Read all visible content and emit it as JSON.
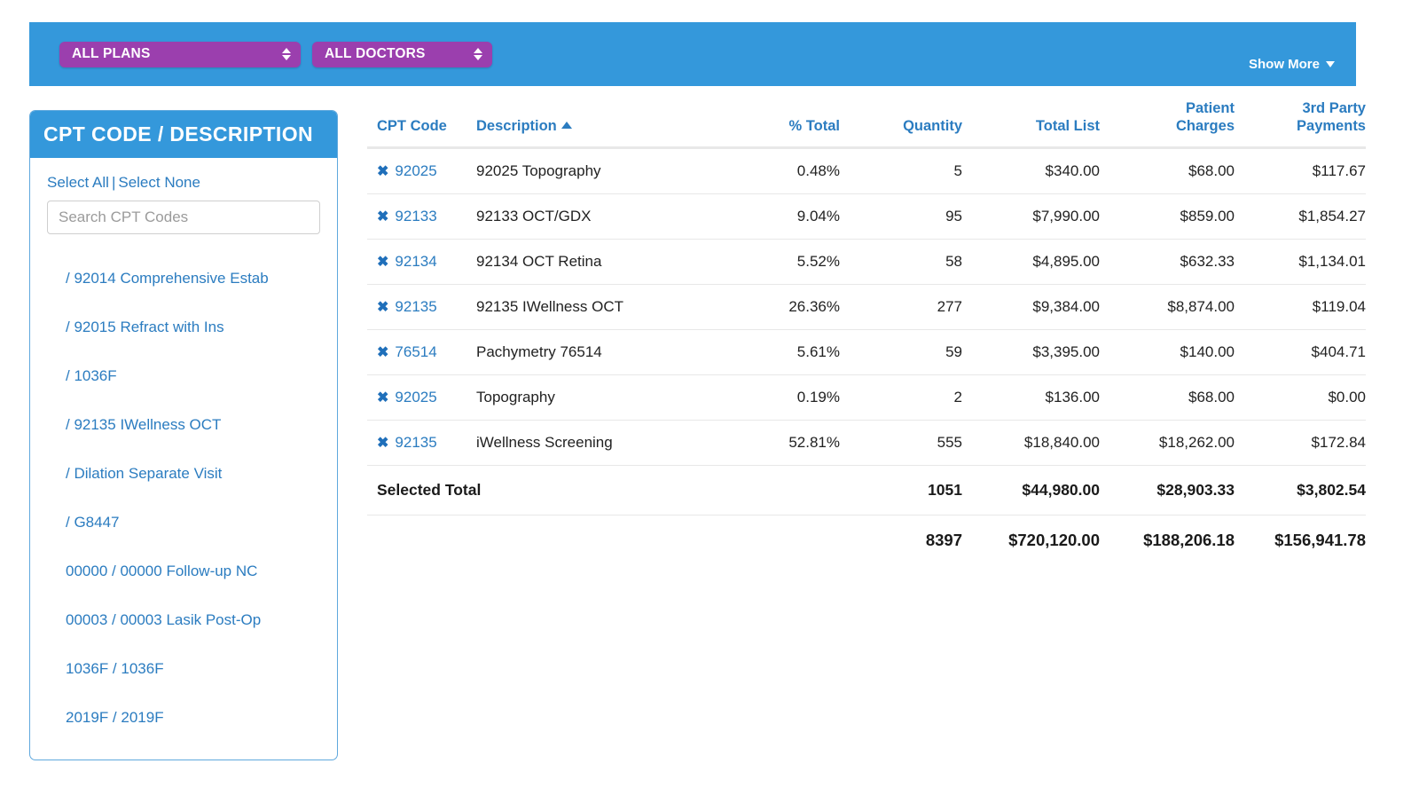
{
  "filter_bar": {
    "plans_select": {
      "label": "ALL PLANS",
      "icon": "select-arrows-icon"
    },
    "doctors_select": {
      "label": "ALL DOCTORS",
      "icon": "select-arrows-icon"
    },
    "show_more": {
      "label": "Show More",
      "icon": "caret-down-icon"
    },
    "background_color": "#3498db",
    "pill_color": "#9b3fae"
  },
  "sidebar": {
    "title": "CPT CODE / DESCRIPTION",
    "select_all": "Select All",
    "separator": "|",
    "select_none": "Select None",
    "search": {
      "placeholder": "Search CPT Codes",
      "value": ""
    },
    "items": [
      {
        "label": "/ 92014 Comprehensive Estab"
      },
      {
        "label": "/ 92015 Refract with Ins"
      },
      {
        "label": "/ 1036F"
      },
      {
        "label": "/ 92135 IWellness OCT"
      },
      {
        "label": "/ Dilation Separate Visit"
      },
      {
        "label": "/ G8447"
      },
      {
        "label": "00000 / 00000 Follow-up NC"
      },
      {
        "label": "00003 / 00003 Lasik Post-Op"
      },
      {
        "label": "1036F / 1036F"
      },
      {
        "label": "2019F / 2019F"
      }
    ]
  },
  "table": {
    "headers": {
      "cpt_code": "CPT Code",
      "description": "Description",
      "description_sort": "ascending",
      "pct_total": "% Total",
      "quantity": "Quantity",
      "total_list": "Total List",
      "patient_charges_line1": "Patient",
      "patient_charges_line2": "Charges",
      "third_party_line1": "3rd Party",
      "third_party_line2": "Payments"
    },
    "remove_icon": "✖",
    "rows": [
      {
        "code": "92025",
        "description": "92025 Topography",
        "pct": "0.48%",
        "qty": "5",
        "total_list": "$340.00",
        "patient_charges": "$68.00",
        "third_party": "$117.67"
      },
      {
        "code": "92133",
        "description": "92133 OCT/GDX",
        "pct": "9.04%",
        "qty": "95",
        "total_list": "$7,990.00",
        "patient_charges": "$859.00",
        "third_party": "$1,854.27"
      },
      {
        "code": "92134",
        "description": "92134 OCT Retina",
        "pct": "5.52%",
        "qty": "58",
        "total_list": "$4,895.00",
        "patient_charges": "$632.33",
        "third_party": "$1,134.01"
      },
      {
        "code": "92135",
        "description": "92135 IWellness OCT",
        "pct": "26.36%",
        "qty": "277",
        "total_list": "$9,384.00",
        "patient_charges": "$8,874.00",
        "third_party": "$119.04"
      },
      {
        "code": "76514",
        "description": "Pachymetry 76514",
        "pct": "5.61%",
        "qty": "59",
        "total_list": "$3,395.00",
        "patient_charges": "$140.00",
        "third_party": "$404.71"
      },
      {
        "code": "92025",
        "description": "Topography",
        "pct": "0.19%",
        "qty": "2",
        "total_list": "$136.00",
        "patient_charges": "$68.00",
        "third_party": "$0.00"
      },
      {
        "code": "92135",
        "description": "iWellness Screening",
        "pct": "52.81%",
        "qty": "555",
        "total_list": "$18,840.00",
        "patient_charges": "$18,262.00",
        "third_party": "$172.84"
      }
    ],
    "selected_total": {
      "label": "Selected Total",
      "qty": "1051",
      "total_list": "$44,980.00",
      "patient_charges": "$28,903.33",
      "third_party": "$3,802.54"
    },
    "grand_total": {
      "label": "",
      "qty": "8397",
      "total_list": "$720,120.00",
      "patient_charges": "$188,206.18",
      "third_party": "$156,941.78"
    }
  },
  "colors": {
    "brand_blue": "#3498db",
    "link_blue": "#2b7cc0",
    "purple": "#9b3fae",
    "row_border": "#e8e8e8"
  }
}
